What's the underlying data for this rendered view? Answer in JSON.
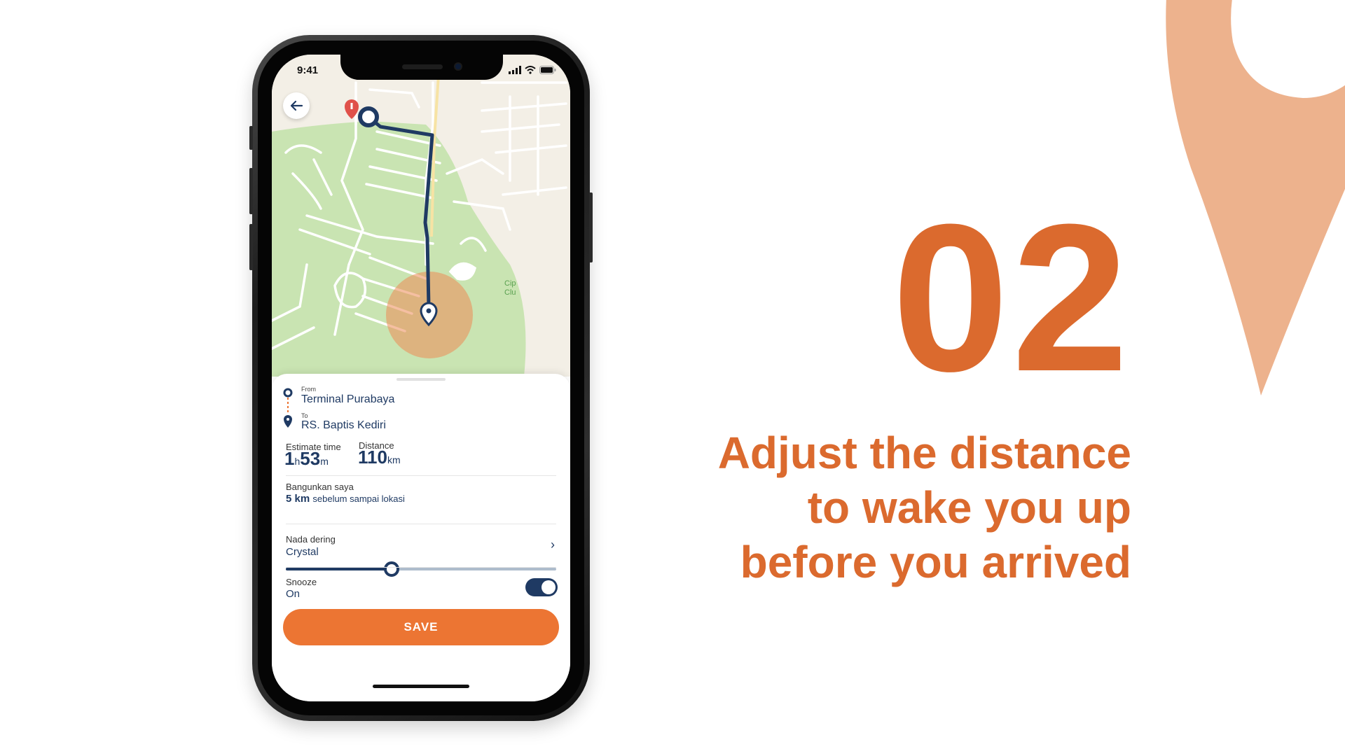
{
  "colors": {
    "accent": "#DB6A2E",
    "button": "#EC7533",
    "navy": "#1f3a63",
    "pin_deco": "#EDB28D",
    "map_park": "#c9e4b2",
    "map_land": "#f3efe6"
  },
  "slide": {
    "step_number": "02",
    "headline": [
      "Adjust the distance",
      "to wake you up",
      "before you arrived"
    ]
  },
  "phone": {
    "status_time": "9:41",
    "map": {
      "label_fragment": "Cip Clu",
      "icons": [
        "back-arrow-icon",
        "start-marker-icon",
        "destination-marker-icon",
        "red-pin-icon"
      ]
    },
    "route": {
      "from_label": "From",
      "from_value": "Terminal Purabaya",
      "to_label": "To",
      "to_value": "RS. Baptis Kediri"
    },
    "estimate": {
      "label": "Estimate time",
      "hours": "1",
      "hours_unit": "h",
      "minutes": "53",
      "minutes_unit": "m"
    },
    "distance": {
      "label": "Distance",
      "value": "110",
      "unit": "km"
    },
    "wake": {
      "label": "Bangunkan saya",
      "value_bold": "5 km",
      "value_rest": "sebelum sampai lokasi",
      "slider_fraction": 0.39
    },
    "ringtone": {
      "label": "Nada dering",
      "value": "Crystal"
    },
    "snooze": {
      "label": "Snooze",
      "value": "On",
      "enabled": true
    },
    "save_label": "SAVE"
  }
}
